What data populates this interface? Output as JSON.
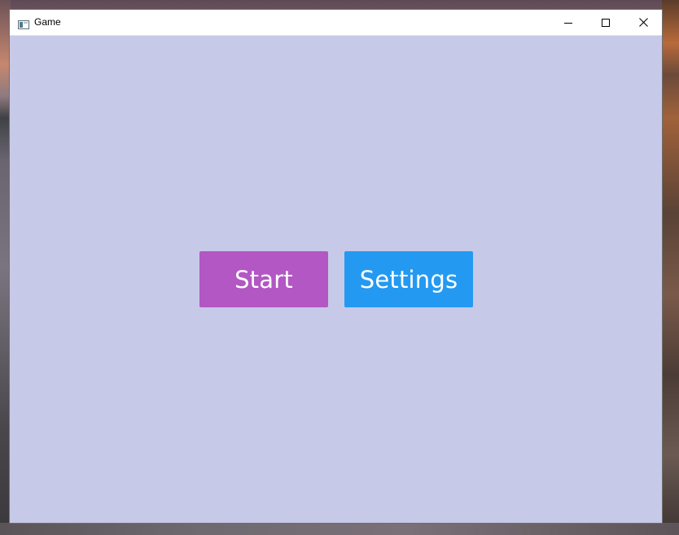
{
  "window": {
    "title": "Game",
    "background_color": "#c7c9e8",
    "controls": {
      "minimize_icon": "minimize-icon",
      "maximize_icon": "maximize-icon",
      "close_icon": "close-icon"
    }
  },
  "menu": {
    "start_label": "Start",
    "start_color": "#b257c3",
    "settings_label": "Settings",
    "settings_color": "#2499f1"
  }
}
